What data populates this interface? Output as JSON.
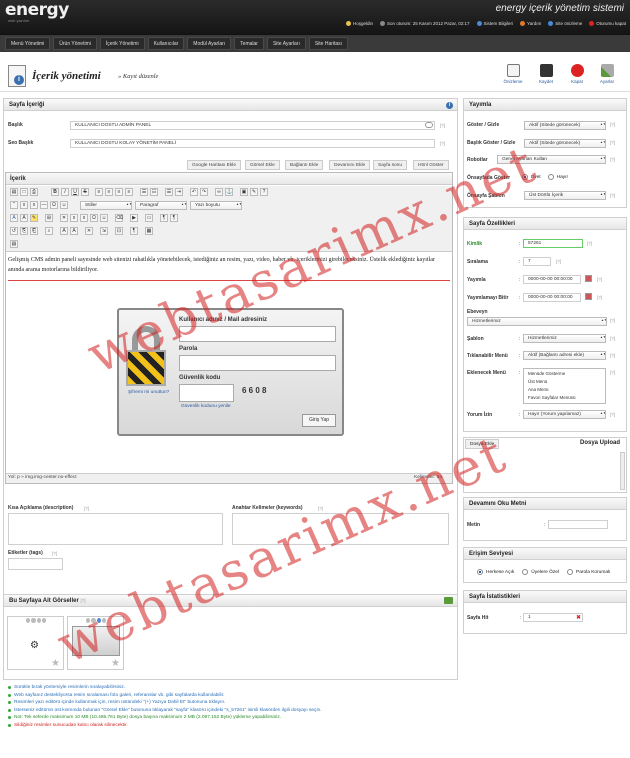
{
  "header": {
    "logo": "energy",
    "logo_sub": "web yazılım",
    "app_title": "energy içerik yönetim sistemi",
    "welcome": "Hoşgeldin",
    "last_login": "Son oturum: 25 Kasım 2012 Pazar, 02:17",
    "links": [
      "Sistem Bilgileri",
      "Yardım",
      "Site önizleme",
      "Oturumu kapat"
    ]
  },
  "nav": [
    "Menü Yönetimi",
    "Ürün Yönetimi",
    "İçerik Yönetimi",
    "Kullanıcılar",
    "Modül Ayarları",
    "Temalar",
    "Site Ayarları",
    "Site Haritası"
  ],
  "page": {
    "title": "İçerik yönetimi",
    "subtitle": "» Kayıt düzenle"
  },
  "toolbar": {
    "preview": "Önizleme",
    "save": "Kaydet",
    "close": "Kapat",
    "settings": "Ayarlar"
  },
  "content": {
    "section": "Sayfa İçeriği",
    "title_label": "Başlık",
    "title_value": "KULLANICI DOSTU ADMİN PANEL",
    "seo_label": "Seo Başlık",
    "seo_value": "KULLANICI DOSTU KOLAY YÖNETİM PANELİ",
    "help": "[?]",
    "tabs": [
      "Google Haritası Ekle",
      "Görsel Ekle",
      "Bağlantı Ekle",
      "Devamını Ekle",
      "Sayfa sonu",
      "Html Göster"
    ],
    "editor_label": "İçerik",
    "style_select": "Stiller",
    "format_select": "Paragraf",
    "size_select": "Yazı boyutu",
    "text": "Gelişmiş CMS admin paneli sayesinde web sitenizi rahatlıkla yönetebilecek, istediğiniz an resim, yazı, video, haber vb. içeriklerinizi girebileceksiniz. Üstelik eklediğiniz kayıtlar anında arama motorlarına bildiriliyor.",
    "login_user": "Kullanıcı adınız / Mail adresiniz",
    "login_pass": "Parola",
    "login_code": "Güvenlik kodu",
    "captcha": "6 6 0 8",
    "forgot": "Şifremi mi unuttun?",
    "refresh": "Güvenlik kodunu yenile",
    "login_btn": "Giriş Yap",
    "path": "Yol: p » img.img-center.no-effect",
    "words": "Kelimeler: 34",
    "desc_label": "Kısa Açıklama (description)",
    "kw_label": "Anahtar Kelimeler (keywords)",
    "tags_label": "Etiketler (tags)"
  },
  "publish": {
    "section": "Yayımla",
    "fields": [
      {
        "label": "Göster / Gizle",
        "value": "Aktif (Sitede görünecek)"
      },
      {
        "label": "Başlık Göster / Gizle",
        "value": "Aktif (Sitede görünecek)"
      },
      {
        "label": "Robotlar",
        "value": "Genel Ayarları Kullan"
      }
    ],
    "show_front": "Önsayfada Göster",
    "yes": "Evet",
    "no": "Hayır",
    "template_label": "Önsayfa Şablon",
    "template_value": "Üst Dörtlü İçerik"
  },
  "props": {
    "section": "Sayfa Özellikleri",
    "id_label": "Kimlik",
    "id_value": "57261",
    "order_label": "Sıralama",
    "order_value": "7",
    "pub_label": "Yayımla",
    "pub_value": "0000-00-00 00:00:00",
    "end_label": "Yayımlamayı Bitir",
    "end_value": "0000-00-00 00:00:00",
    "parent_label": "Ebeveyn",
    "parent_value": "Hizmetlerimiz",
    "tpl_label": "Şablon",
    "tpl_value": "Hizmetlerimiz",
    "click_label": "Tıklanabilir Menü",
    "click_value": "Aktif (Bağlantı adresi ekle)",
    "menu_label": "Eklenecek Menü",
    "menu_items": [
      "Menüde Gösterme",
      "Üst Menü",
      "Ana Menü",
      "Favori Sayfalar Menüsü"
    ],
    "comment_label": "Yorum İzin",
    "comment_value": "Hayır (Yorum yapılamaz)"
  },
  "upload": {
    "tab": "Dosya Ekle",
    "title": "Dosya Upload"
  },
  "more": {
    "section": "Devamını Oku Metni",
    "label": "Metin"
  },
  "access": {
    "section": "Erişim Seviyesi",
    "options": [
      "Herkese Açık",
      "Üyelere Özel",
      "Parola Korumalı"
    ]
  },
  "stats": {
    "section": "Sayfa İstatistikleri",
    "hit_label": "Sayfa Hit",
    "hit_value": "1"
  },
  "gallery": {
    "section": "Bu Sayfaya Ait Görseller"
  },
  "notes": [
    {
      "text": "Sürükle bırak yöntemiyle resimlerin sıralayabilirsiniz.",
      "color": "#2a6fb8"
    },
    {
      "text": "Web sayfanız destekliyorsa resim sıralaması foto galeri, referanslar vb. gibi sayfalarda kullanılabilir.",
      "color": "#2a6fb8"
    },
    {
      "text": "Resimleri yazı editörü içinde kullanmak için, resim üstündeki \"(+) Yazıya Dahil Et\" butonuna tıklayın.",
      "color": "#2a6fb8"
    },
    {
      "text": "İsterseniz editörün üst kısmında bulunan \"Görsel Ekle\" butonuna tıklayarak \"sayfa\" klasörü içindeki \"s_57261\" isimli klasörden ilgili dosyayı seçin.",
      "color": "#2a6fb8"
    },
    {
      "text": "Not: Tek seferde maksimum 10 MB (10.485.761 Byte) dosya başına maksimum 2 MB (2.097.152 Byte) yükleme yapabilirsiniz.",
      "color": "#2a8a2a"
    },
    {
      "text": "Sildiğiniz resimler sunucudan kalıcı olarak silinecektir.",
      "color": "#cc2222"
    }
  ],
  "watermark": "webtasarimx.net",
  "colors": {
    "header": "#1e1e1e",
    "accent": "#3a6fb0",
    "watermark": "#d21e1e"
  }
}
